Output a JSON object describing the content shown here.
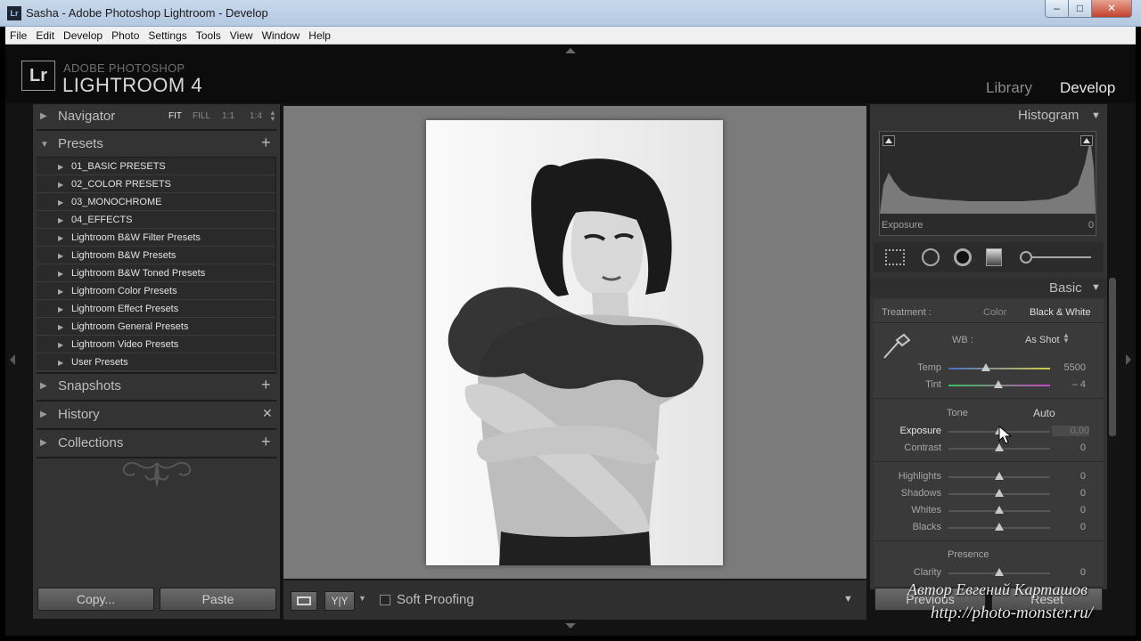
{
  "window": {
    "title": "Sasha - Adobe Photoshop Lightroom - Develop",
    "app_icon": "Lr",
    "controls": [
      "–",
      "□",
      "✕"
    ]
  },
  "menu": [
    "File",
    "Edit",
    "Develop",
    "Photo",
    "Settings",
    "Tools",
    "View",
    "Window",
    "Help"
  ],
  "identity": {
    "logo": "Lr",
    "brand_line1": "ADOBE PHOTOSHOP",
    "brand_line2": "LIGHTROOM 4",
    "modules": [
      "Library",
      "Develop"
    ],
    "active_module": "Develop"
  },
  "left_panel": {
    "navigator": {
      "label": "Navigator",
      "zoom_options": [
        "FIT",
        "FILL",
        "1:1",
        "1:4"
      ],
      "active_zoom": "FIT"
    },
    "presets": {
      "label": "Presets",
      "items": [
        "01_BASIC PRESETS",
        "02_COLOR PRESETS",
        "03_MONOCHROME",
        "04_EFFECTS",
        "Lightroom B&W Filter Presets",
        "Lightroom B&W Presets",
        "Lightroom B&W Toned Presets",
        "Lightroom Color Presets",
        "Lightroom Effect Presets",
        "Lightroom General Presets",
        "Lightroom Video Presets",
        "User Presets"
      ]
    },
    "snapshots": {
      "label": "Snapshots"
    },
    "history": {
      "label": "History"
    },
    "collections": {
      "label": "Collections"
    },
    "copy_label": "Copy...",
    "paste_label": "Paste"
  },
  "toolbar": {
    "soft_proofing_label": "Soft Proofing",
    "yy_label": "Y|Y"
  },
  "right_panel": {
    "histogram": {
      "label": "Histogram",
      "readout_label": "Exposure",
      "readout_value": "0"
    },
    "basic": {
      "label": "Basic",
      "treatment_label": "Treatment :",
      "treatment_options": [
        "Color",
        "Black & White"
      ],
      "active_treatment": "Black & White",
      "wb_label": "WB :",
      "wb_value": "As Shot",
      "sliders_wb": [
        {
          "name": "Temp",
          "value": "5500",
          "pos": 0.37
        },
        {
          "name": "Tint",
          "value": "– 4",
          "pos": 0.49
        }
      ],
      "tone_label": "Tone",
      "auto_label": "Auto",
      "sliders_tone": [
        {
          "name": "Exposure",
          "value": "0,00",
          "pos": 0.5
        },
        {
          "name": "Contrast",
          "value": "0",
          "pos": 0.5
        }
      ],
      "sliders_region": [
        {
          "name": "Highlights",
          "value": "0",
          "pos": 0.5
        },
        {
          "name": "Shadows",
          "value": "0",
          "pos": 0.5
        },
        {
          "name": "Whites",
          "value": "0",
          "pos": 0.5
        },
        {
          "name": "Blacks",
          "value": "0",
          "pos": 0.5
        }
      ],
      "presence_label": "Presence",
      "sliders_presence": [
        {
          "name": "Clarity",
          "value": "0",
          "pos": 0.5
        }
      ]
    },
    "previous_label": "Previous",
    "reset_label": "Reset"
  },
  "watermark": {
    "line1": "Автор Евгений Карташов",
    "line2": "http://photo-monster.ru/"
  },
  "colors": {
    "panel_bg": "#333333",
    "app_bg": "#131313",
    "title_bar": "#b9cce3"
  }
}
